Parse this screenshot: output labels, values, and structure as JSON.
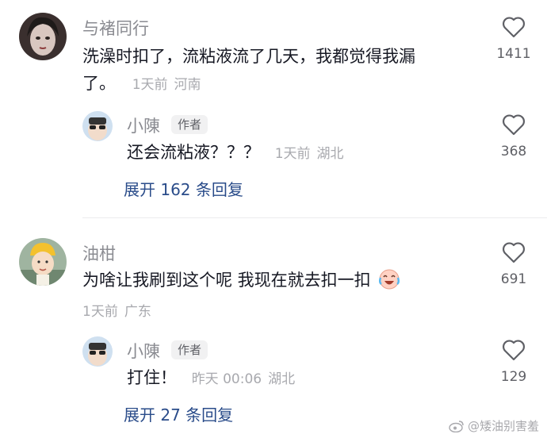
{
  "comments": [
    {
      "user": "与褚同行",
      "text_line1": "洗澡时扣了，流粘液流了几天，我都觉得我漏",
      "text_line2": "了。",
      "time": "1天前",
      "location": "河南",
      "likes": "1411",
      "reply": {
        "user": "小陳",
        "badge": "作者",
        "text": "还会流粘液？？？",
        "time": "1天前",
        "location": "湖北",
        "likes": "368"
      },
      "expand_label": "展开 162 条回复"
    },
    {
      "user": "油柑",
      "text": "为啥让我刷到这个呢 我现在就去扣一扣",
      "time": "1天前",
      "location": "广东",
      "likes": "691",
      "reply": {
        "user": "小陳",
        "badge": "作者",
        "text": "打住！",
        "time": "昨天 00:06",
        "location": "湖北",
        "likes": "129"
      },
      "expand_label": "展开 27 条回复"
    }
  ],
  "watermark": "@矮油别害羞",
  "icons": {
    "like": "heart-outline-icon",
    "emoji": "crying-laughing-emoji-icon",
    "weibo": "weibo-logo-icon"
  },
  "colors": {
    "link": "#2a4c8a",
    "meta": "#a8a9ae",
    "name": "#8a8b91"
  }
}
